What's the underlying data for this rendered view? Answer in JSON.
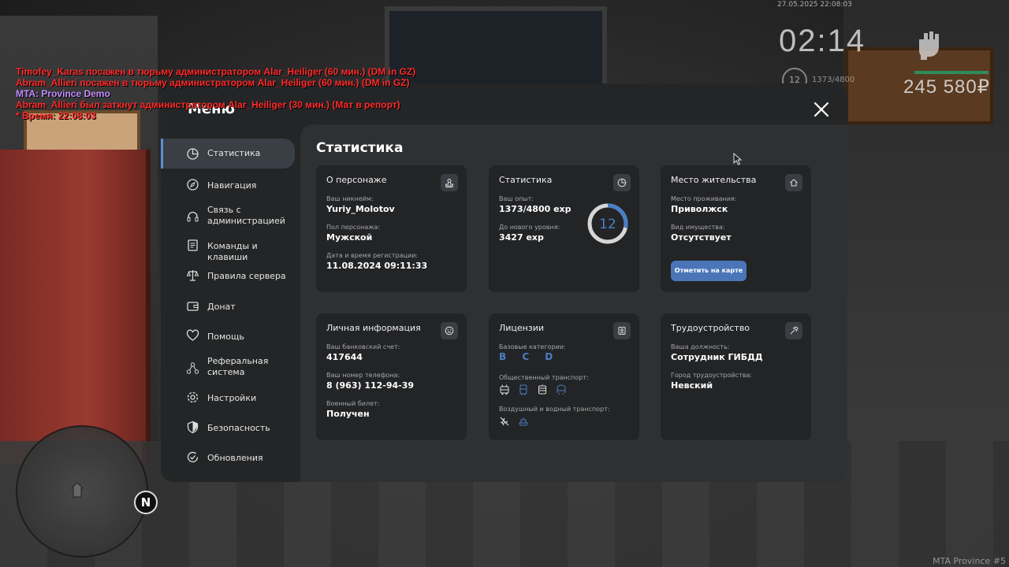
{
  "hud": {
    "chat": [
      {
        "text": "Timofey_Karas посажен в тюрьму администратором Alar_Heiliger (60 мин.) (DM in GZ)",
        "color": "#ff2a2a"
      },
      {
        "text": "Abram_Allieri посажен в тюрьму администратором Alar_Heiliger (60 мин.) (DM in GZ)",
        "color": "#ff2a2a"
      },
      {
        "text": "MTA: Province Demo",
        "color": "#c28cff"
      },
      {
        "text": "Abram_Allieri был заткнут администратором Alar_Heiliger (30 мин.) (Мат в репорт)",
        "color": "#ff2a2a"
      },
      {
        "text": "* Время: 22:08:03",
        "color": "#ff2a2a"
      }
    ],
    "datetime": "27.05.2025 22:08:03",
    "clock": "02:14",
    "level": "12",
    "exp": "1373/4800",
    "money": "245 580₽",
    "north": "N",
    "watermark": "MTA Province #5"
  },
  "menu": {
    "title": "Меню",
    "sidebar": [
      {
        "label": "Статистика",
        "icon": "pie-chart-icon"
      },
      {
        "label": "Навигация",
        "icon": "compass-icon"
      },
      {
        "label": "Связь с администрацией",
        "icon": "headset-icon"
      },
      {
        "label": "Команды и клавиши",
        "icon": "document-icon"
      },
      {
        "label": "Правила сервера",
        "icon": "scales-icon"
      },
      {
        "label": "Донат",
        "icon": "wallet-icon"
      },
      {
        "label": "Помощь",
        "icon": "heart-hand-icon"
      },
      {
        "label": "Реферальная система",
        "icon": "network-icon"
      },
      {
        "label": "Настройки",
        "icon": "gear-icon"
      },
      {
        "label": "Безопасность",
        "icon": "shield-icon"
      },
      {
        "label": "Обновления",
        "icon": "refresh-check-icon"
      }
    ]
  },
  "content": {
    "title": "Статистика",
    "character": {
      "title": "О персонаже",
      "nickname_label": "Ваш никнейм:",
      "nickname": "Yuriy_Molotov",
      "gender_label": "Пол персонажа:",
      "gender": "Мужской",
      "reg_label": "Дата и время регистрации:",
      "reg": "11.08.2024 09:11:33"
    },
    "stats": {
      "title": "Статистика",
      "exp_label": "Ваш опыт:",
      "exp": "1373/4800 exp",
      "next_label": "До нового уровня:",
      "next": "3427 exp",
      "level": "12",
      "progress": 0.286
    },
    "residence": {
      "title": "Место жительства",
      "place_label": "Место проживания:",
      "place": "Приволжск",
      "property_label": "Вид имущества:",
      "property": "Отсутствует",
      "button": "Отметить на карте"
    },
    "personal": {
      "title": "Личная информация",
      "bank_label": "Ваш банковский счет:",
      "bank": "417644",
      "phone_label": "Ваш номер телефона:",
      "phone": "8 (963) 112-94-39",
      "military_label": "Военный билет:",
      "military": "Получен"
    },
    "licenses": {
      "title": "Лицензии",
      "base_label": "Базовые категории:",
      "base": "B C D",
      "public_label": "Общественный транспорт:",
      "air_label": "Воздушный и водный транспорт:"
    },
    "employment": {
      "title": "Трудоустройство",
      "position_label": "Ваша должность:",
      "position": "Сотрудник ГИБДД",
      "city_label": "Город трудоустройства:",
      "city": "Невский"
    }
  },
  "colors": {
    "accent": "#4a76b8",
    "ring": "#4a7ec4"
  }
}
